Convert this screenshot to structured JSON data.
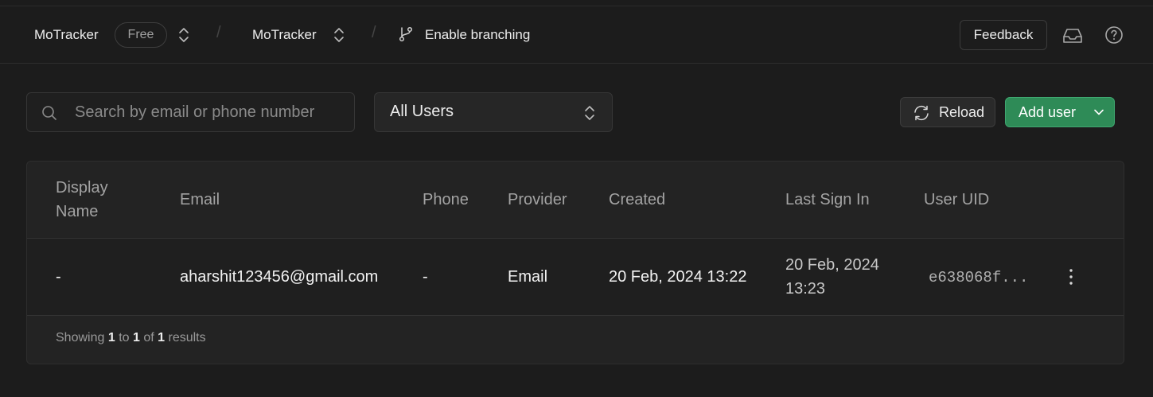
{
  "header": {
    "org_name": "MoTracker",
    "plan_badge": "Free",
    "project_name": "MoTracker",
    "branching_label": "Enable branching",
    "feedback_label": "Feedback"
  },
  "toolbar": {
    "search_placeholder": "Search by email or phone number",
    "search_value": "",
    "user_filter": "All Users",
    "reload_label": "Reload",
    "add_user_label": "Add user"
  },
  "table": {
    "columns": [
      "Display Name",
      "Email",
      "Phone",
      "Provider",
      "Created",
      "Last Sign In",
      "User UID"
    ],
    "rows": [
      {
        "display_name": "-",
        "email": "aharshit123456@gmail.com",
        "phone": "-",
        "provider": "Email",
        "created": "20 Feb, 2024 13:22",
        "last_sign_in": "20 Feb, 2024 13:23",
        "user_uid": "e638068f..."
      }
    ],
    "footer": {
      "prefix": "Showing",
      "from": "1",
      "to_word": "to",
      "to": "1",
      "of_word": "of",
      "total": "1",
      "suffix": "results"
    }
  },
  "icons": {
    "updown": "chevrons-up-down-icon",
    "branch": "git-branch-icon",
    "inbox": "inbox-icon",
    "help": "help-circle-icon",
    "search": "search-icon",
    "reload": "refresh-icon",
    "chevron_down": "chevron-down-icon",
    "more": "more-vertical-icon"
  },
  "colors": {
    "background": "#1c1c1c",
    "accent_green": "#2e8b57"
  }
}
